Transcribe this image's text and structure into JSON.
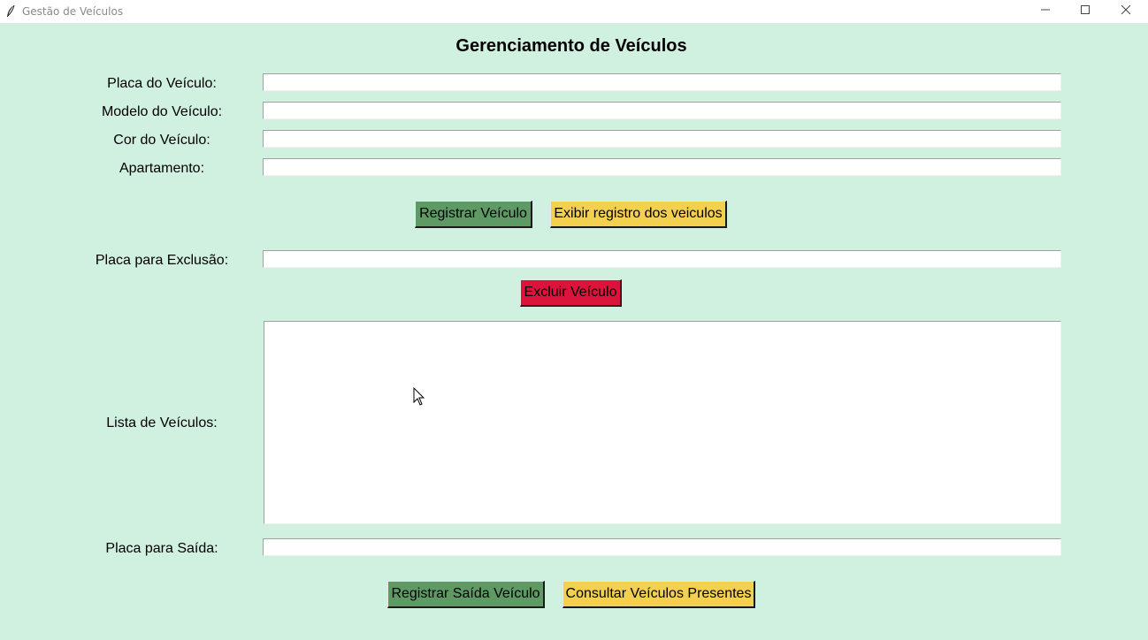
{
  "window": {
    "title": "Gestão de Veículos"
  },
  "heading": "Gerenciamento de Veículos",
  "form": {
    "placa_label": "Placa do Veículo:",
    "placa_value": "",
    "modelo_label": "Modelo do Veículo:",
    "modelo_value": "",
    "cor_label": "Cor do Veículo:",
    "cor_value": "",
    "apartamento_label": "Apartamento:",
    "apartamento_value": ""
  },
  "buttons": {
    "registrar": "Registrar Veículo",
    "exibir": "Exibir registro dos veiculos",
    "excluir": "Excluir Veículo",
    "registrar_saida": "Registrar Saída Veículo",
    "consultar": "Consultar Veículos Presentes"
  },
  "exclusao": {
    "label": "Placa para Exclusão:",
    "value": ""
  },
  "lista": {
    "label": "Lista de Veículos:",
    "items": []
  },
  "saida": {
    "label": "Placa para Saída:",
    "value": ""
  },
  "colors": {
    "background": "#d0f0e0",
    "green_button": "#5f9a65",
    "yellow_button": "#f3d04f",
    "red_button": "#dc143c"
  },
  "icons": {
    "app": "feather-icon",
    "minimize": "minimize-icon",
    "maximize": "maximize-icon",
    "close": "close-icon",
    "cursor": "mouse-pointer-icon"
  }
}
